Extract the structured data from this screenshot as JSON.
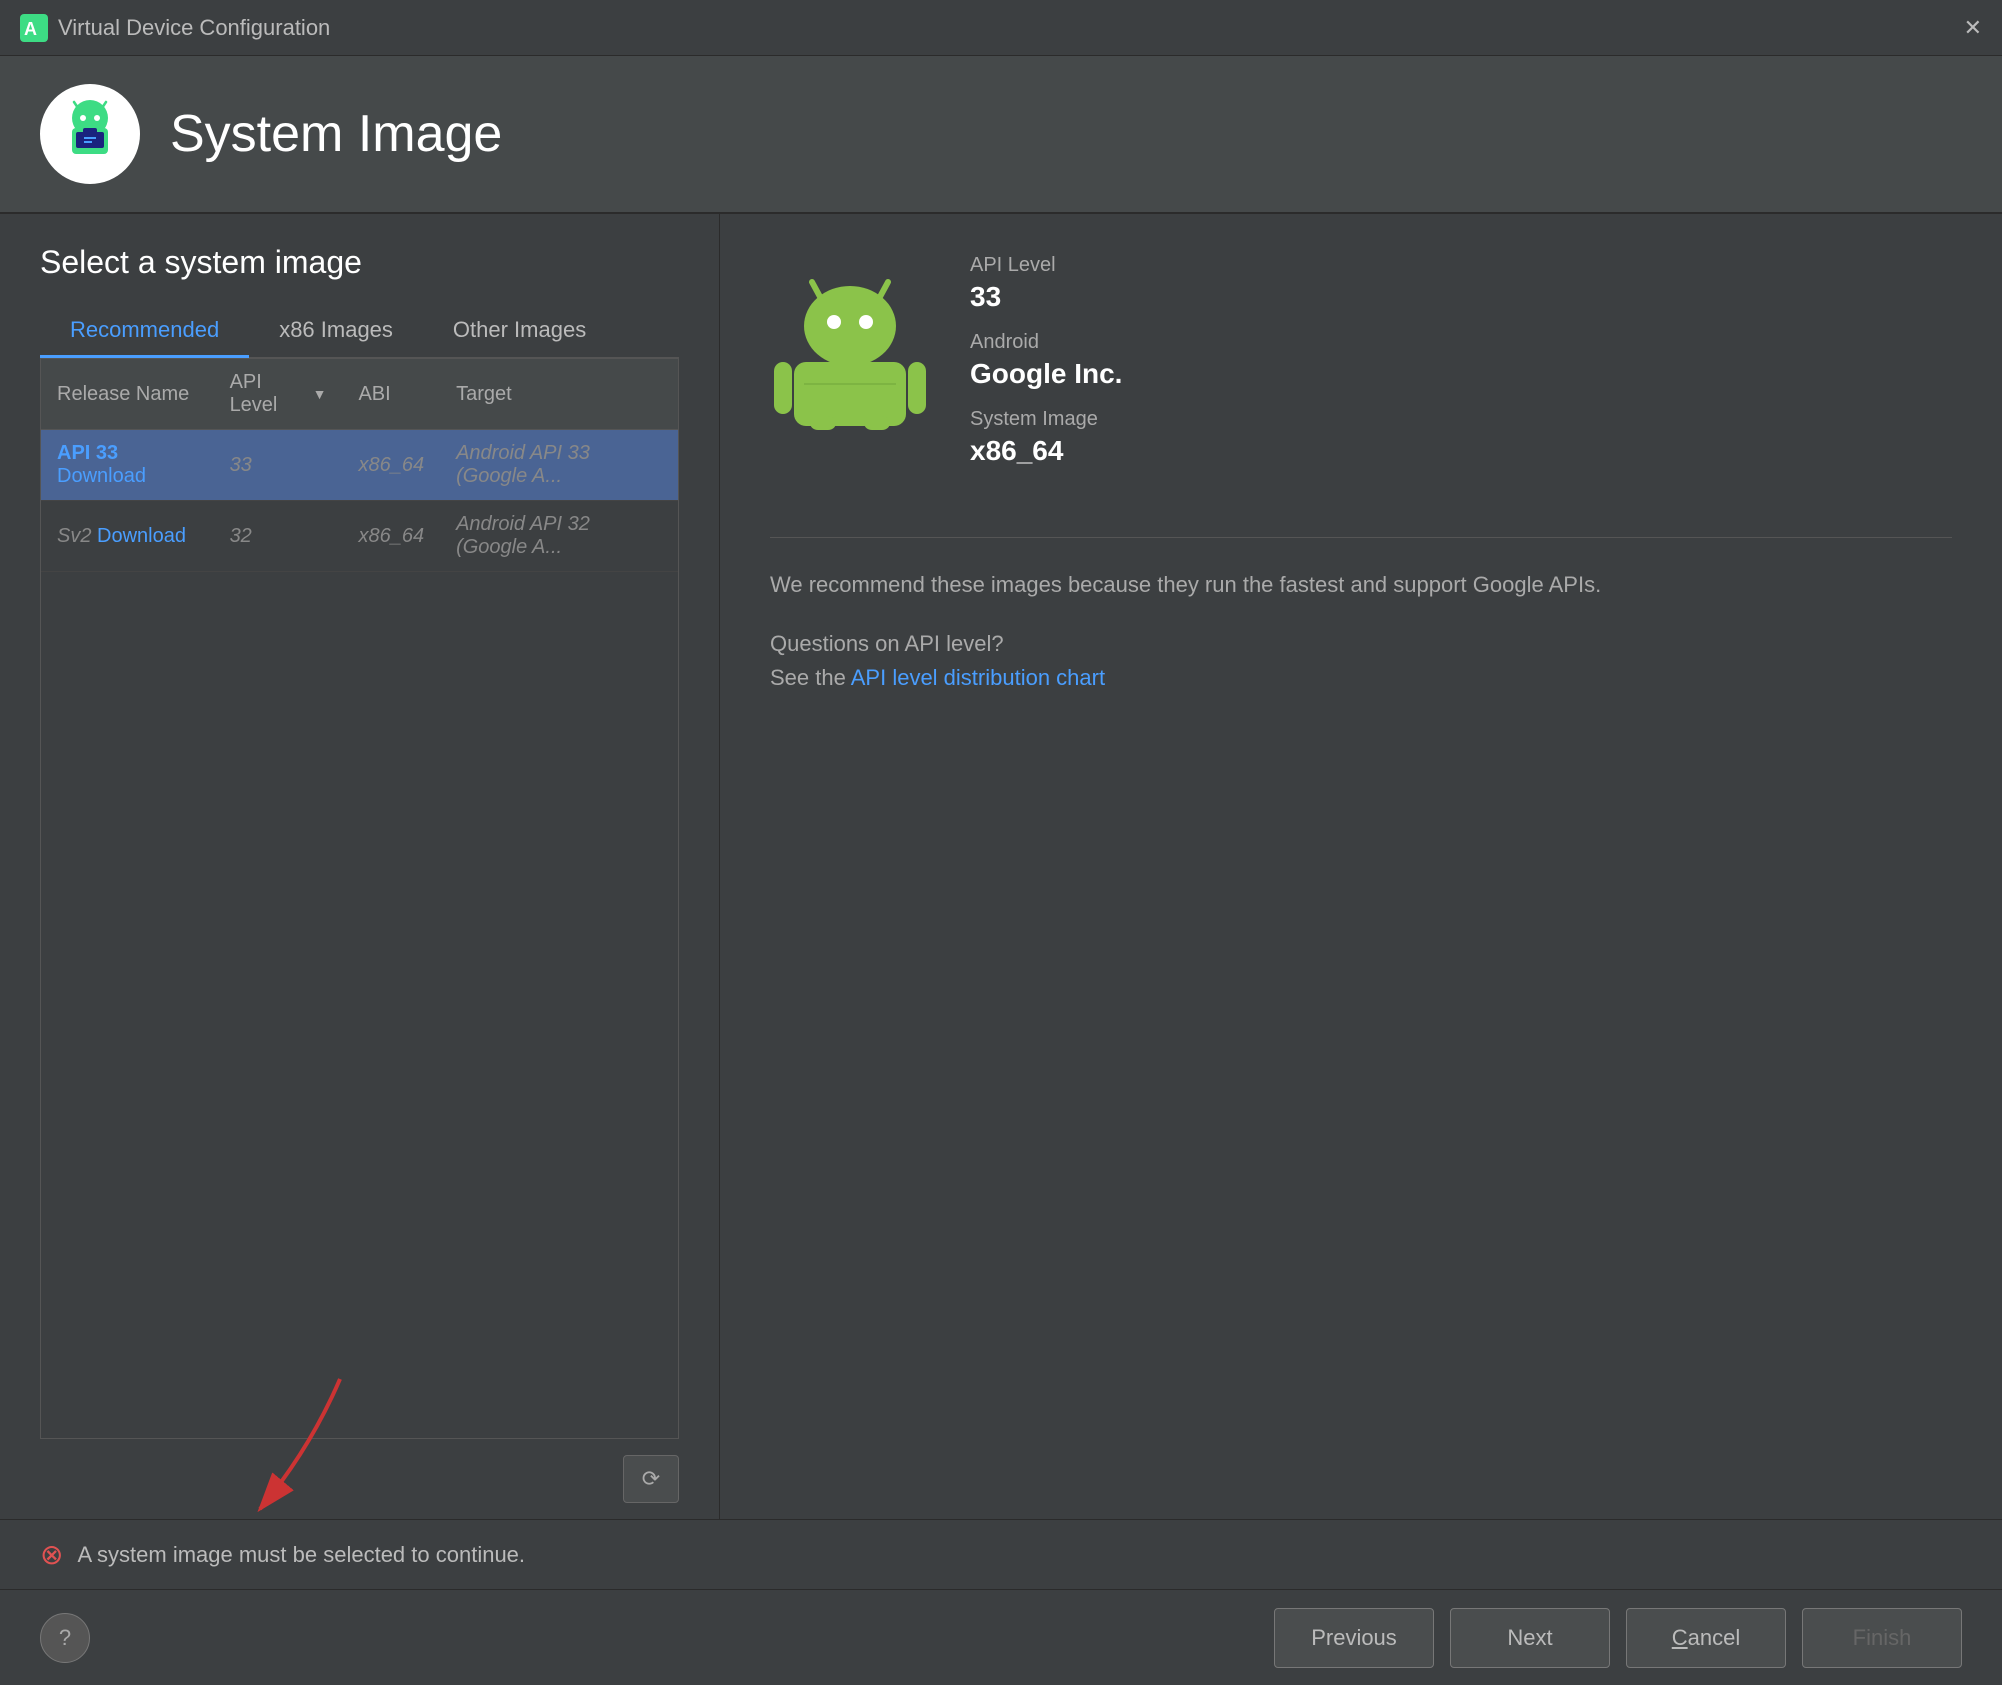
{
  "titleBar": {
    "icon": "android-studio-icon",
    "title": "Virtual Device Configuration",
    "closeLabel": "✕"
  },
  "header": {
    "title": "System Image",
    "iconAlt": "system-image-icon"
  },
  "leftPanel": {
    "selectTitle": "Select a system image",
    "tabs": [
      {
        "id": "recommended",
        "label": "Recommended",
        "active": true
      },
      {
        "id": "x86images",
        "label": "x86 Images",
        "active": false
      },
      {
        "id": "otherimages",
        "label": "Other Images",
        "active": false
      }
    ],
    "tableHeaders": [
      {
        "id": "releaseName",
        "label": "Release Name",
        "sortable": false
      },
      {
        "id": "apiLevel",
        "label": "API Level",
        "sortable": true
      },
      {
        "id": "abi",
        "label": "ABI",
        "sortable": false
      },
      {
        "id": "target",
        "label": "Target",
        "sortable": false
      }
    ],
    "tableRows": [
      {
        "id": "row1",
        "selected": true,
        "releaseName": "API 33",
        "releaseNameLink": "Download",
        "releaseNameBold": true,
        "apiLevel": "33",
        "abi": "x86_64",
        "target": "Android API 33 (Google A..."
      },
      {
        "id": "row2",
        "selected": false,
        "releaseName": "Sv2",
        "releaseNameLink": "Download",
        "releaseNameBold": false,
        "apiLevel": "32",
        "abi": "x86_64",
        "target": "Android API 32 (Google A..."
      }
    ],
    "refreshButtonLabel": "⟳",
    "errorText": "A system image must be selected to continue.",
    "errorIcon": "●"
  },
  "rightPanel": {
    "apiLevelLabel": "API Level",
    "apiLevelValue": "33",
    "androidLabel": "Android",
    "androidValue": "Google Inc.",
    "systemImageLabel": "System Image",
    "systemImageValue": "x86_64",
    "recommendText": "We recommend these images because they run the fastest and support Google APIs.",
    "questionsLabel": "Questions on API level?",
    "seeText": "See the",
    "linkText": "API level distribution chart"
  },
  "footer": {
    "helpLabel": "?",
    "previousLabel": "Previous",
    "nextLabel": "Next",
    "cancelLabel": "Cancel",
    "finishLabel": "Finish"
  }
}
